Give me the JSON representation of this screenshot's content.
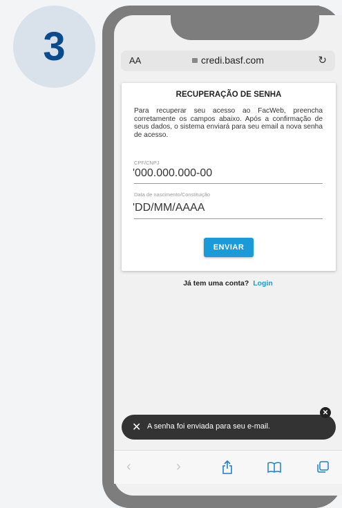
{
  "step": {
    "number": "3"
  },
  "browser": {
    "aa_label": "AA",
    "url": "credi.basf.com"
  },
  "form": {
    "title": "RECUPERAÇÃO DE SENHA",
    "description": "Para recuperar seu acesso ao FacWeb, preencha corretamente os campos abaixo. Após a confirmação de seus dados, o sistema enviará para seu email a nova senha de acesso.",
    "cpf_label": "CPF/CNPJ",
    "cpf_value": "'000.000.000-00",
    "date_label": "Data de nascimento/Constituição",
    "date_value": "'DD/MM/AAAA",
    "submit_label": "ENVIAR"
  },
  "account": {
    "prompt": "Já tem uma conta?",
    "login_label": "Login"
  },
  "toast": {
    "message": "A senha foi enviada para seu e-mail."
  },
  "colors": {
    "accent": "#1a9bd7",
    "step_number": "#0b4a8c"
  },
  "icons": [
    "reload-icon",
    "lock-icon",
    "close-icon",
    "back-icon",
    "forward-icon",
    "share-icon",
    "bookmarks-icon",
    "tabs-icon"
  ]
}
